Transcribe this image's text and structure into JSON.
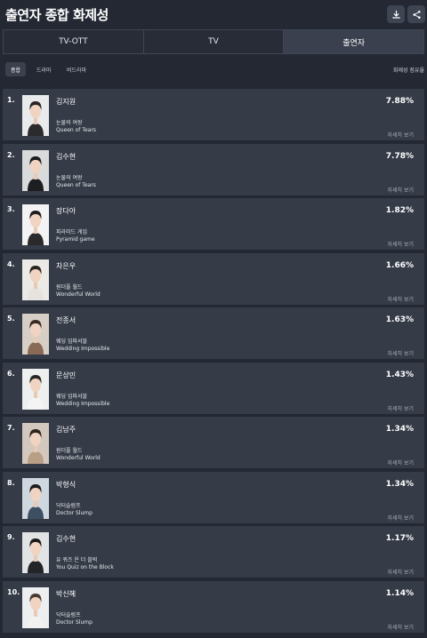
{
  "header": {
    "title": "출연자 종합 화제성",
    "download_icon": "download-icon",
    "share_icon": "share-icon"
  },
  "tabs": [
    {
      "label": "TV-OTT",
      "active": false
    },
    {
      "label": "TV",
      "active": false
    },
    {
      "label": "출연자",
      "active": true
    }
  ],
  "filters": [
    {
      "label": "종합",
      "active": true
    },
    {
      "label": "드라마",
      "active": false
    },
    {
      "label": "비드라마",
      "active": false
    }
  ],
  "share_column_label": "화제성 점유율",
  "detail_label": "자세히 보기",
  "rankings": [
    {
      "rank": "1.",
      "name": "김지원",
      "show_ko": "눈물의 여왕",
      "show_en": "Queen of Tears",
      "share": "7.88%",
      "photo_bg": "#e9eaec",
      "hair": "#2a2522",
      "top": "#2b2b2e"
    },
    {
      "rank": "2.",
      "name": "김수현",
      "show_ko": "눈물의 여왕",
      "show_en": "Queen of Tears",
      "share": "7.78%",
      "photo_bg": "#d9dadc",
      "hair": "#1b1b1c",
      "top": "#1d1e22"
    },
    {
      "rank": "3.",
      "name": "장다아",
      "show_ko": "피라미드 게임",
      "show_en": "Pyramid game",
      "share": "1.82%",
      "photo_bg": "#f3f3f3",
      "hair": "#201c1b",
      "top": "#2a2a2c"
    },
    {
      "rank": "4.",
      "name": "차은우",
      "show_ko": "원더풀 월드",
      "show_en": "Wonderful World",
      "share": "1.66%",
      "photo_bg": "#eceae6",
      "hair": "#2c2621",
      "top": "#e6e3de"
    },
    {
      "rank": "5.",
      "name": "전종서",
      "show_ko": "웨딩 임파서블",
      "show_en": "Wedding Impossible",
      "share": "1.63%",
      "photo_bg": "#d7cfc6",
      "hair": "#3b2a22",
      "top": "#8a6a55"
    },
    {
      "rank": "6.",
      "name": "문상민",
      "show_ko": "웨딩 임파서블",
      "show_en": "Wedding Impossible",
      "share": "1.43%",
      "photo_bg": "#eef0f0",
      "hair": "#2a2622",
      "top": "#f4f4f4"
    },
    {
      "rank": "7.",
      "name": "김남주",
      "show_ko": "원더풀 월드",
      "show_en": "Wonderful World",
      "share": "1.34%",
      "photo_bg": "#d2c8be",
      "hair": "#2e241e",
      "top": "#b89f86"
    },
    {
      "rank": "8.",
      "name": "박형식",
      "show_ko": "닥터슬럼프",
      "show_en": "Doctor Slump",
      "share": "1.34%",
      "photo_bg": "#cfd8df",
      "hair": "#1f1d1c",
      "top": "#3d4f63"
    },
    {
      "rank": "9.",
      "name": "김수현",
      "show_ko": "유 퀴즈 온 더 블럭",
      "show_en": "You Quiz on the Block",
      "share": "1.17%",
      "photo_bg": "#e2e3e4",
      "hair": "#1a1a1b",
      "top": "#232428"
    },
    {
      "rank": "10.",
      "name": "박신혜",
      "show_ko": "닥터슬럼프",
      "show_en": "Doctor Slump",
      "share": "1.14%",
      "photo_bg": "#eceeef",
      "hair": "#4a3b31",
      "top": "#f1f1f1"
    }
  ]
}
